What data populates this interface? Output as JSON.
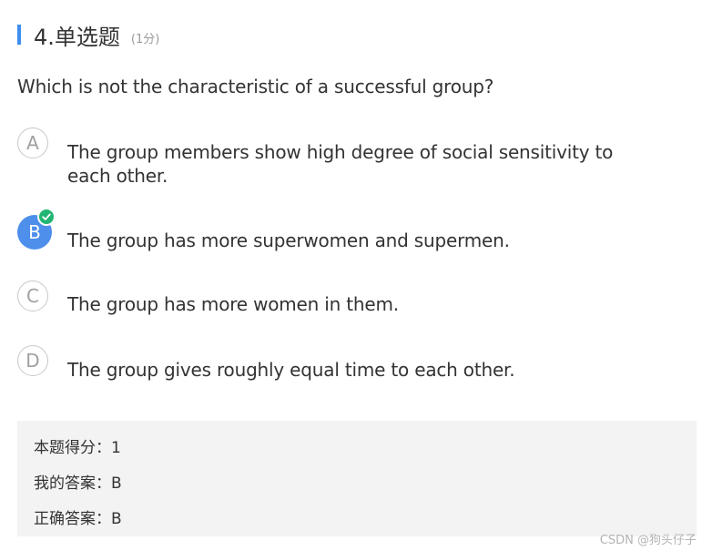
{
  "question": {
    "title": "4.单选题",
    "score": "(1分)",
    "text": "Which is not the characteristic of a successful group?"
  },
  "options": [
    {
      "letter": "A",
      "text": "The group members show high degree of social sensitivity to each other.",
      "selected": false
    },
    {
      "letter": "B",
      "text": "The group has more superwomen and supermen.",
      "selected": true
    },
    {
      "letter": "C",
      "text": "The group has more women in them.",
      "selected": false
    },
    {
      "letter": "D",
      "text": "The group gives roughly equal time to each other.",
      "selected": false
    }
  ],
  "result": {
    "score_line": "本题得分：1",
    "my_answer_line": "我的答案：B",
    "correct_answer_line": "正确答案：B"
  },
  "watermark": "CSDN @狗头仔子",
  "icons": {
    "selected_check": "check-icon"
  },
  "colors": {
    "accent": "#3d8ef0",
    "selected_option": "#4d8fea",
    "correct_check": "#21b573",
    "result_background": "#f3f3f3"
  }
}
